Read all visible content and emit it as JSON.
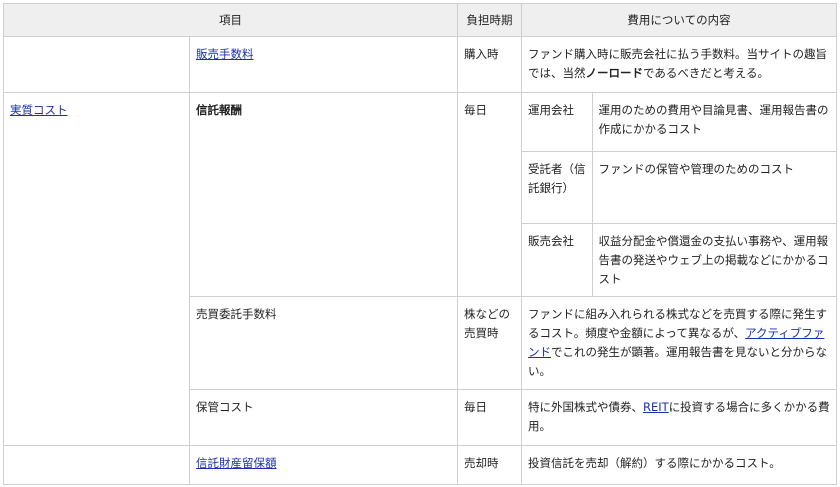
{
  "table": {
    "headers": {
      "item": "項目",
      "timing": "負担時期",
      "content": "費用についての内容"
    },
    "rows": {
      "sales_fee": {
        "item": "販売手数料",
        "timing": "購入時",
        "content": {
          "a": "ファンド購入時に販売会社に払う手数料。当サイトの趣旨では、当然",
          "b": "ノーロード",
          "c": "であるべきだと考える。"
        }
      },
      "real_cost_label": "実質コスト",
      "trust_fee": {
        "item": "信託報酬",
        "timing": "毎日",
        "sub": [
          {
            "party": "運用会社",
            "desc": "運用のための費用や目論見書、運用報告書の作成にかかるコスト"
          },
          {
            "party": "受託者（信託銀行）",
            "desc": "ファンドの保管や管理のためのコスト"
          },
          {
            "party": "販売会社",
            "desc": "収益分配金や償還金の支払い事務や、運用報告書の発送やウェブ上の掲載などにかかるコスト"
          }
        ]
      },
      "trading_commission": {
        "item": "売買委託手数料",
        "timing": "株などの売買時",
        "content": {
          "a": "ファンドに組み入れられる株式などを売買する際に発生するコスト。頻度や金額によって異なるが、",
          "link": "アクティブファンド",
          "b": "でこれの発生が顕著。運用報告書を見ないと分からない。"
        }
      },
      "custody_cost": {
        "item": "保管コスト",
        "timing": "毎日",
        "content": {
          "a": "特に外国株式や債券、",
          "link": "REIT",
          "b": "に投資する場合に多くかかる費用。"
        }
      },
      "retention": {
        "item": "信託財産留保額",
        "timing": "売却時",
        "content": "投資信託を売却（解約）する際にかかるコスト。"
      }
    }
  }
}
